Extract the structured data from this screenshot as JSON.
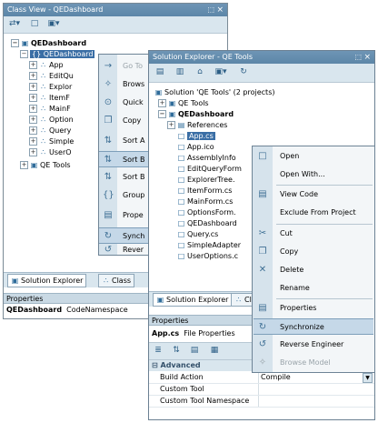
{
  "class_view": {
    "title": "Class View - QEDashboard",
    "pin": "⬚",
    "close": "×",
    "toolbar": [
      {
        "icon": "⇄▾"
      },
      {
        "icon": "□"
      },
      {
        "icon": "▣▾"
      }
    ],
    "tree": [
      {
        "label": "QEDashboard",
        "bold": true,
        "icon": "▣",
        "exp": "−"
      },
      {
        "label": "{} QEDashboard",
        "selected": true,
        "exp": "−"
      },
      {
        "label": "App",
        "icon": "∴",
        "exp": "+"
      },
      {
        "label": "EditQu",
        "icon": "∴",
        "exp": "+"
      },
      {
        "label": "Explor",
        "icon": "∴",
        "exp": "+"
      },
      {
        "label": "ItemF",
        "icon": "∴",
        "exp": "+"
      },
      {
        "label": "MainF",
        "icon": "∴",
        "exp": "+"
      },
      {
        "label": "Option",
        "icon": "∴",
        "exp": "+"
      },
      {
        "label": "Query",
        "icon": "∴",
        "exp": "+"
      },
      {
        "label": "Simple",
        "icon": "∴",
        "exp": "+"
      },
      {
        "label": "UserO",
        "icon": "∴",
        "exp": "+"
      },
      {
        "label": "QE Tools",
        "icon": "▣",
        "exp": "+"
      }
    ],
    "menu": [
      {
        "label": "Go To",
        "icon": "→",
        "disabled": true
      },
      {
        "label": "Brows",
        "icon": "✧"
      },
      {
        "label": "Quick",
        "icon": "⊙"
      },
      {
        "label": "Copy",
        "icon": "❐"
      },
      {
        "label": "Sort A",
        "icon": "⇅"
      },
      {
        "label": "Sort B",
        "icon": "⇅",
        "highlighted": true
      },
      {
        "label": "Sort B",
        "icon": "⇅"
      },
      {
        "label": "Group",
        "icon": "{}"
      },
      {
        "label": "Prope",
        "icon": "▤"
      },
      {
        "label": "Synch",
        "icon": "↻",
        "highlighted": true
      },
      {
        "label": "Rever",
        "icon": "↺"
      }
    ],
    "tabs": [
      "Solution Explorer",
      "Class"
    ],
    "properties_header": "Properties",
    "properties_object": "QEDashboard",
    "properties_type": "CodeNamespace"
  },
  "solution_explorer": {
    "title": "Solution Explorer - QE Tools",
    "pin": "⬚",
    "close": "×",
    "toolbar": [
      {
        "icon": "▤"
      },
      {
        "icon": "▥"
      },
      {
        "icon": "⌂"
      },
      {
        "icon": "▣▾"
      },
      {
        "icon": "↻"
      }
    ],
    "tree": [
      {
        "label": "Solution 'QE Tools' (2 projects)",
        "icon": "▣",
        "indent": 0
      },
      {
        "label": "QE Tools",
        "icon": "▣",
        "indent": 1,
        "exp": "+"
      },
      {
        "label": "QEDashboard",
        "icon": "▣",
        "indent": 1,
        "exp": "−",
        "bold": true
      },
      {
        "label": "References",
        "icon": "▤",
        "indent": 2,
        "exp": "+"
      },
      {
        "label": "App.cs",
        "icon": "□",
        "indent": 2,
        "selected": true
      },
      {
        "label": "App.ico",
        "icon": "□",
        "indent": 2
      },
      {
        "label": "AssemblyInfo",
        "icon": "□",
        "indent": 2
      },
      {
        "label": "EditQueryForm",
        "icon": "□",
        "indent": 2
      },
      {
        "label": "ExplorerTree.",
        "icon": "□",
        "indent": 2
      },
      {
        "label": "ItemForm.cs",
        "icon": "□",
        "indent": 2
      },
      {
        "label": "MainForm.cs",
        "icon": "□",
        "indent": 2
      },
      {
        "label": "OptionsForm.",
        "icon": "□",
        "indent": 2
      },
      {
        "label": "QEDashboard",
        "icon": "□",
        "indent": 2
      },
      {
        "label": "Query.cs",
        "icon": "□",
        "indent": 2
      },
      {
        "label": "SimpleAdapter",
        "icon": "□",
        "indent": 2
      },
      {
        "label": "UserOptions.c",
        "icon": "□",
        "indent": 2
      }
    ],
    "menu": [
      {
        "label": "Open",
        "icon": "□"
      },
      {
        "label": "Open With...",
        "icon": ""
      },
      {
        "label": "View Code",
        "icon": "▤",
        "sep_before": true
      },
      {
        "label": "Exclude From Project",
        "icon": ""
      },
      {
        "label": "Cut",
        "icon": "✂",
        "sep_before": true
      },
      {
        "label": "Copy",
        "icon": "❐"
      },
      {
        "label": "Delete",
        "icon": "✕"
      },
      {
        "label": "Rename",
        "icon": ""
      },
      {
        "label": "Properties",
        "icon": "▤",
        "sep_before": true
      },
      {
        "label": "Synchronize",
        "icon": "↻",
        "highlighted": true
      },
      {
        "label": "Reverse Engineer",
        "icon": "↺"
      },
      {
        "label": "Browse Model",
        "icon": "✧",
        "disabled": true
      }
    ],
    "tabs": [
      "Solution Explorer",
      "Cl"
    ],
    "properties_header": "Properties",
    "properties_object": "App.cs",
    "properties_type": "File Properties",
    "prop_toolbar": [
      {
        "icon": "≣"
      },
      {
        "icon": "⇅"
      },
      {
        "icon": "▤"
      },
      {
        "icon": "▦"
      }
    ],
    "category": "Advanced",
    "properties": [
      {
        "name": "Build Action",
        "value": "Compile",
        "dropdown": true
      },
      {
        "name": "Custom Tool",
        "value": ""
      },
      {
        "name": "Custom Tool Namespace",
        "value": ""
      }
    ]
  },
  "colors": {
    "selection": "#3a6ea5",
    "titlebar": "#5c86a8",
    "menu_highlight": "#c5d8e8"
  }
}
